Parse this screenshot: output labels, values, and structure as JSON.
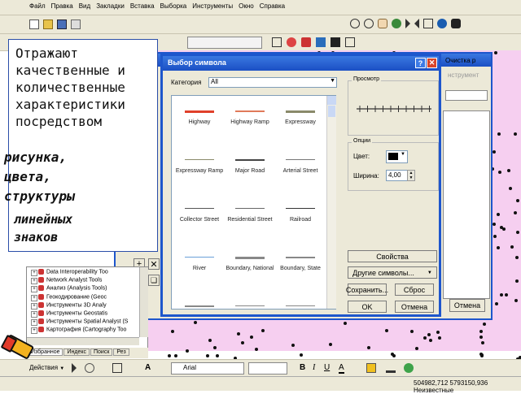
{
  "menu": [
    "Файл",
    "Правка",
    "Вид",
    "Закладки",
    "Вставка",
    "Выборка",
    "Инструменты",
    "Окно",
    "Справка"
  ],
  "callout": {
    "lines": [
      "Отражают",
      "качественные и",
      "количественные",
      "характеристики",
      "посредством"
    ],
    "handwritten": [
      "рисунка,",
      "цвета,",
      "структуры"
    ],
    "tail": [
      "линейных",
      "знаков"
    ]
  },
  "dialog": {
    "title": "Выбор символа",
    "category_label": "Категория",
    "category_value": "All",
    "preview_label": "Просмотр",
    "options_label": "Опции",
    "color_label": "Цвет:",
    "width_label": "Ширина:",
    "width_value": "4,00",
    "properties_button": "Свойства",
    "more_symbols_button": "Другие символы...",
    "save_button": "Сохранить...",
    "reset_button": "Сброс",
    "ok_button": "OK",
    "cancel_button": "Отмена",
    "symbols": [
      {
        "label": "Highway",
        "color": "#e0402a",
        "thickness": 3
      },
      {
        "label": "Highway Ramp",
        "color": "#e07a5a",
        "thickness": 2
      },
      {
        "label": "Expressway",
        "color": "#8a8a6a",
        "thickness": 3
      },
      {
        "label": "Expressway Ramp",
        "color": "#8a8a6a",
        "thickness": 1
      },
      {
        "label": "Major Road",
        "color": "#444444",
        "thickness": 2
      },
      {
        "label": "Arterial Street",
        "color": "#777777",
        "thickness": 1
      },
      {
        "label": "Collector Street",
        "color": "#555555",
        "thickness": 1
      },
      {
        "label": "Residential Street",
        "color": "#666666",
        "thickness": 1
      },
      {
        "label": "Railroad",
        "color": "#333333",
        "thickness": 1
      },
      {
        "label": "River",
        "color": "#6aa0d8",
        "thickness": 1
      },
      {
        "label": "Boundary, National",
        "color": "#888888",
        "thickness": 3
      },
      {
        "label": "Boundary, State",
        "color": "#888888",
        "thickness": 2
      },
      {
        "label": "",
        "color": "#888888",
        "thickness": 2
      },
      {
        "label": "",
        "color": "#888888",
        "thickness": 1
      },
      {
        "label": "",
        "color": "#888888",
        "thickness": 1
      }
    ]
  },
  "back_dialog": {
    "title_fragment": "Очистка р",
    "subtitle_fragment": "нструмент",
    "cancel_button": "Отмена"
  },
  "toolbox": {
    "items": [
      "Data Interoperability Too",
      "Network Analyst Tools",
      "Анализ (Analysis Tools)",
      "Геокодирование (Geoc",
      "Инструменты 3D Analy",
      "Инструменты Geostatis",
      "Инструменты Spatial Analyst (S",
      "Картография (Cartography Too"
    ],
    "tabs": [
      "Избранное",
      "Индекс",
      "Поиск",
      "Рез"
    ]
  },
  "bottom_toolbar": {
    "actions_label": "Действия",
    "font_value": "Arial",
    "bold": "B",
    "italic": "I",
    "underline": "U",
    "text_A": "A"
  },
  "status_bar": {
    "coordinates": "504982,712  5793150,936 Неизвестные"
  },
  "colors": {
    "map_background": "#f6cff0",
    "dialog_frame": "#1e56cc",
    "callout_border": "#2b4ea8",
    "toolbar": "#ece9d8"
  }
}
